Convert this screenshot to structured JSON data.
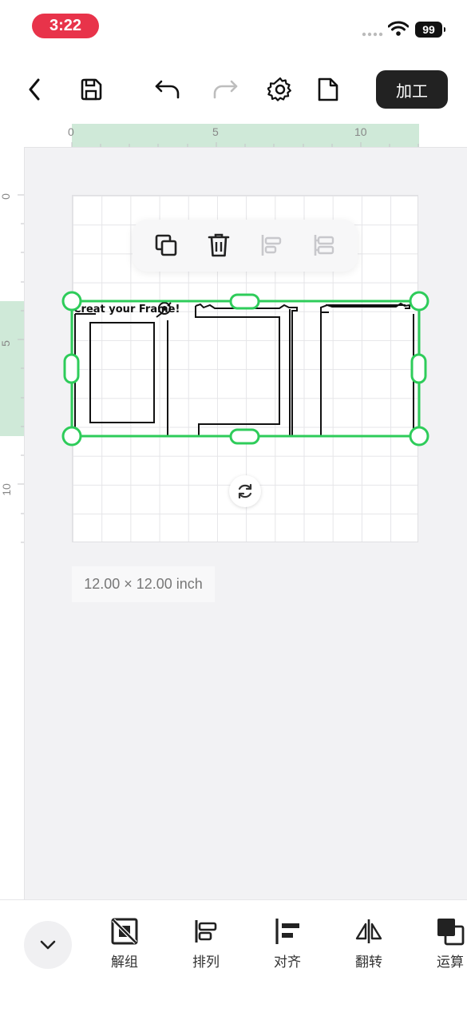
{
  "status_bar": {
    "time": "3:22",
    "battery": "99"
  },
  "toolbar": {
    "back_icon": "chevron-left-icon",
    "save_icon": "save-icon",
    "undo_icon": "undo-icon",
    "redo_icon": "redo-icon",
    "settings_icon": "gear-icon",
    "file_icon": "file-icon",
    "process_label": "加工"
  },
  "ruler": {
    "top_ticks": [
      "0",
      "5",
      "10"
    ],
    "left_ticks": [
      "0",
      "5",
      "10"
    ]
  },
  "canvas": {
    "size_label": "12.00 × 12.00 inch",
    "selection_color": "#2ecc5a",
    "design_text": "Creat your Frame!",
    "floating_toolbar": [
      "duplicate-icon",
      "delete-icon",
      "arrange-icon",
      "align-icon"
    ]
  },
  "bottom_tools": [
    {
      "icon": "ungroup-icon",
      "label": "解组"
    },
    {
      "icon": "arrange-icon",
      "label": "排列"
    },
    {
      "icon": "align-icon",
      "label": "对齐"
    },
    {
      "icon": "flip-icon",
      "label": "翻转"
    },
    {
      "icon": "boolean-ops-icon",
      "label": "运算"
    }
  ]
}
